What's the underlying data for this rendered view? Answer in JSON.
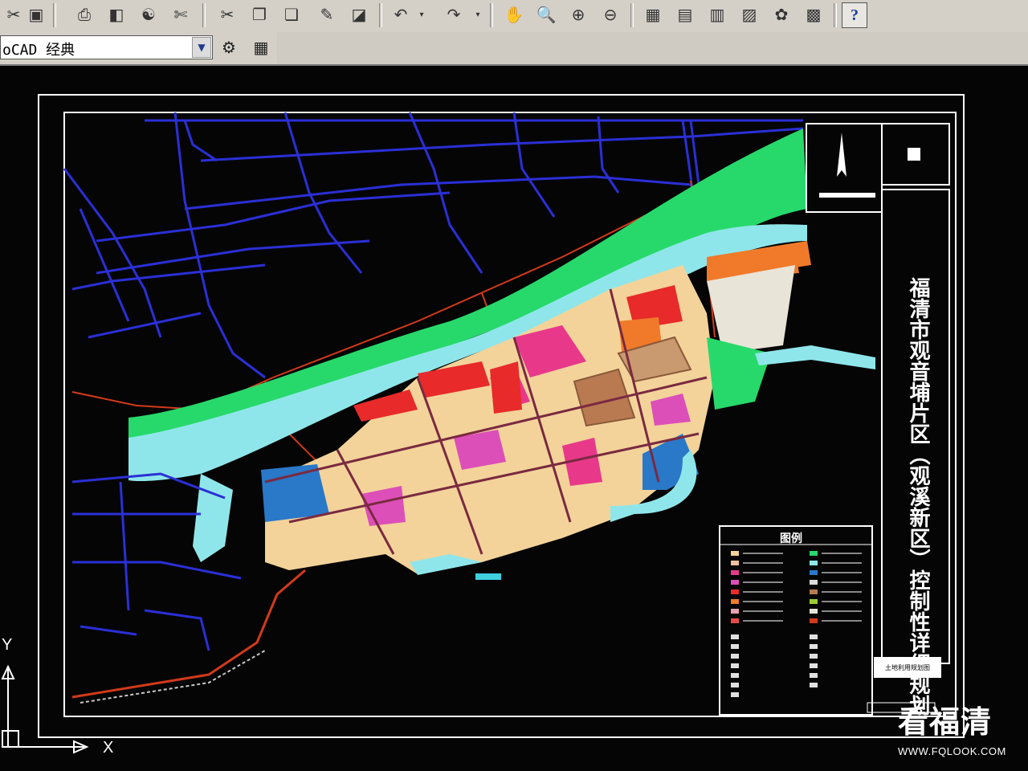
{
  "toolbar": {
    "buttons": [
      {
        "name": "cut-icon",
        "glyph": "✂"
      },
      {
        "name": "save-icon",
        "glyph": "▣"
      },
      {
        "name": "print-icon",
        "glyph": "⎙"
      },
      {
        "name": "plot-preview-icon",
        "glyph": "◧"
      },
      {
        "name": "publish-icon",
        "glyph": "☯"
      },
      {
        "name": "match-properties-icon",
        "glyph": "✄"
      },
      {
        "name": "copy-icon",
        "glyph": "❐"
      },
      {
        "name": "paste-icon",
        "glyph": "❏"
      },
      {
        "name": "brush-icon",
        "glyph": "✎"
      },
      {
        "name": "block-editor-icon",
        "glyph": "◪"
      },
      {
        "name": "undo-icon",
        "glyph": "↶"
      },
      {
        "name": "redo-icon",
        "glyph": "↷"
      },
      {
        "name": "pan-icon",
        "glyph": "✋"
      },
      {
        "name": "zoom-realtime-icon",
        "glyph": "🔍"
      },
      {
        "name": "zoom-window-icon",
        "glyph": "⊕"
      },
      {
        "name": "zoom-previous-icon",
        "glyph": "⊖"
      },
      {
        "name": "properties-icon",
        "glyph": "▦"
      },
      {
        "name": "design-center-icon",
        "glyph": "▤"
      },
      {
        "name": "tool-palettes-icon",
        "glyph": "▥"
      },
      {
        "name": "sheet-set-icon",
        "glyph": "▨"
      },
      {
        "name": "markup-icon",
        "glyph": "✿"
      },
      {
        "name": "calculator-icon",
        "glyph": "▩"
      },
      {
        "name": "help-icon",
        "glyph": "?"
      }
    ]
  },
  "workspace": {
    "selected": "oCAD 经典",
    "settings_icon": "gear-icon",
    "lock_icon": "lock-icon"
  },
  "drawing": {
    "title": "福清市观音埔片区（观溪新区）控制性详细规划",
    "legend_title": "图例",
    "subtitle_box": "土地利用规划图",
    "colors": {
      "river": "#8fe6ea",
      "green_space": "#27d96a",
      "residential": "#f3d39a",
      "commercial": "#e8388a",
      "public": "#e82a2a",
      "industrial": "#f07a2a",
      "water_blue": "#2a78c8",
      "road_blue": "#2b2fd6",
      "road_red": "#d23a1a"
    }
  },
  "ucs": {
    "x_label": "X",
    "y_label": "Y"
  },
  "watermark": {
    "text": "看福清",
    "url": "WWW.FQLOOK.COM"
  }
}
